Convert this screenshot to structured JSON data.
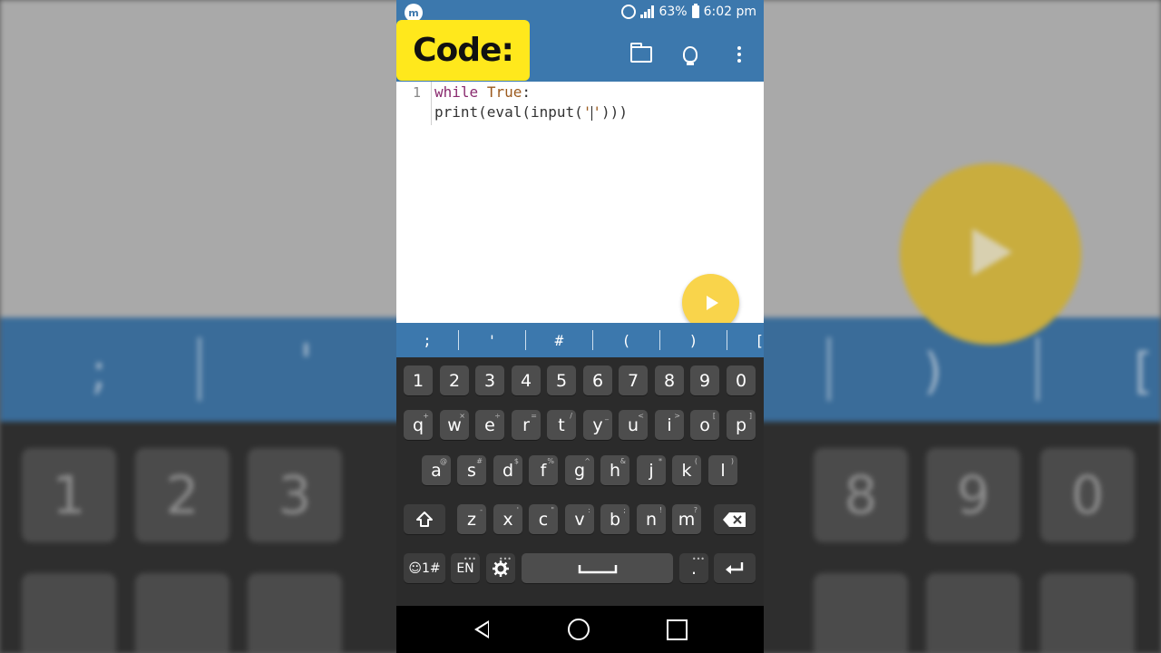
{
  "status": {
    "app_icon": "m",
    "battery": "63%",
    "time": "6:02 pm"
  },
  "overlay": {
    "label": "Code:"
  },
  "toolbar": {
    "icons": [
      "folder-icon",
      "lightbulb-icon",
      "more-vert-icon"
    ]
  },
  "editor": {
    "line_numbers": [
      "1"
    ],
    "line1": {
      "kw1": "while",
      "kw2": "True",
      "rest": ":"
    },
    "line2": {
      "pre": "print(eval(input(",
      "q1": "'",
      "q2": "'",
      "post": ")))"
    }
  },
  "symbols": [
    ";",
    "'",
    "#",
    "(",
    ")",
    "["
  ],
  "keyboard": {
    "numbers": [
      "1",
      "2",
      "3",
      "4",
      "5",
      "6",
      "7",
      "8",
      "9",
      "0"
    ],
    "row1": [
      {
        "k": "q",
        "h": "+"
      },
      {
        "k": "w",
        "h": "×"
      },
      {
        "k": "e",
        "h": "÷"
      },
      {
        "k": "r",
        "h": "="
      },
      {
        "k": "t",
        "h": "/"
      },
      {
        "k": "y",
        "h": "_"
      },
      {
        "k": "u",
        "h": "<"
      },
      {
        "k": "i",
        "h": ">"
      },
      {
        "k": "o",
        "h": "["
      },
      {
        "k": "p",
        "h": "]"
      }
    ],
    "row2": [
      {
        "k": "a",
        "h": "@"
      },
      {
        "k": "s",
        "h": "#"
      },
      {
        "k": "d",
        "h": "$"
      },
      {
        "k": "f",
        "h": "%"
      },
      {
        "k": "g",
        "h": "^"
      },
      {
        "k": "h",
        "h": "&"
      },
      {
        "k": "j",
        "h": "*"
      },
      {
        "k": "k",
        "h": "("
      },
      {
        "k": "l",
        "h": ")"
      }
    ],
    "row3": [
      {
        "k": "z",
        "h": "-"
      },
      {
        "k": "x",
        "h": "'"
      },
      {
        "k": "c",
        "h": "\""
      },
      {
        "k": "v",
        "h": ":"
      },
      {
        "k": "b",
        "h": ";"
      },
      {
        "k": "n",
        "h": "!"
      },
      {
        "k": "m",
        "h": "?"
      }
    ],
    "symbols_key": "☺1#",
    "lang_key": "EN",
    "period_key": "."
  },
  "background": {
    "symbols": [
      ";",
      "'",
      ")",
      "["
    ],
    "numbers": [
      "1",
      "2",
      "3",
      "8",
      "9",
      "0"
    ]
  }
}
